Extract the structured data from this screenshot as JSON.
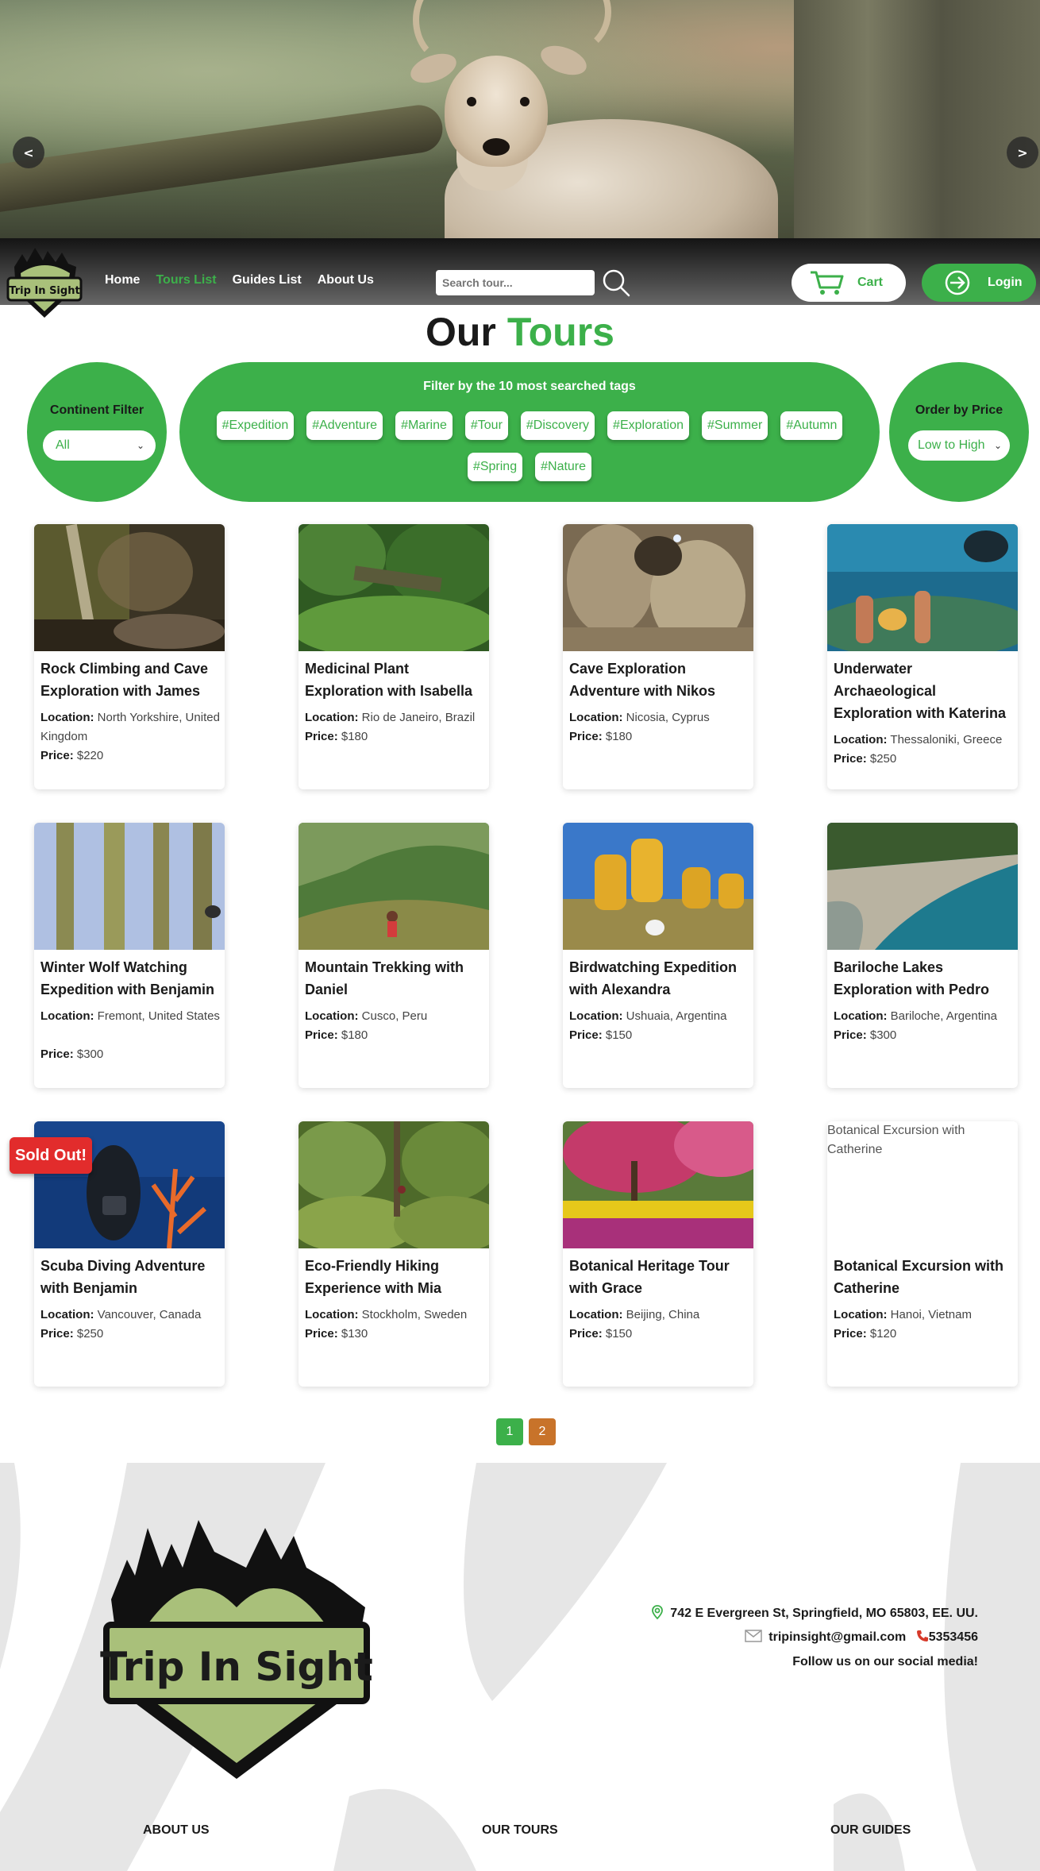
{
  "brand": {
    "name": "Trip In Sight"
  },
  "hero": {
    "prev_label": "<",
    "next_label": ">"
  },
  "nav": {
    "links": [
      "Home",
      "Tours List",
      "Guides List",
      "About Us"
    ],
    "active": "Tours List",
    "search_placeholder": "Search tour...",
    "cart_label": "Cart",
    "login_label": "Login"
  },
  "title": {
    "part1": "Our",
    "part2": "Tours"
  },
  "filters": {
    "continent_label": "Continent Filter",
    "continent_value": "All",
    "tags_title": "Filter by the 10 most searched tags",
    "tags": [
      "#Expedition",
      "#Adventure",
      "#Marine",
      "#Tour",
      "#Discovery",
      "#Exploration",
      "#Summer",
      "#Autumn",
      "#Spring",
      "#Nature"
    ],
    "order_label": "Order by Price",
    "order_value": "Low to High"
  },
  "tours": [
    {
      "title": "Rock Climbing and Cave Exploration with James",
      "location": "North Yorkshire, United Kingdom",
      "price": "$220",
      "image": "cave-forest"
    },
    {
      "title": "Medicinal Plant Exploration with Isabella",
      "location": "Rio de Janeiro, Brazil",
      "price": "$180",
      "image": "rainforest"
    },
    {
      "title": "Cave Exploration Adventure with Nikos",
      "location": "Nicosia, Cyprus",
      "price": "$180",
      "image": "cave"
    },
    {
      "title": "Underwater Archaeological Exploration with Katerina",
      "location": "Thessaloniki, Greece",
      "price": "$250",
      "image": "underwater-ruins"
    },
    {
      "title": "Winter Wolf Watching Expedition with Benjamin",
      "location": "Fremont, United States",
      "price": "$300",
      "image": "snowy-forest"
    },
    {
      "title": "Mountain Trekking with Daniel",
      "location": "Cusco, Peru",
      "price": "$180",
      "image": "mountain-trek"
    },
    {
      "title": "Birdwatching Expedition with Alexandra",
      "location": "Ushuaia, Argentina",
      "price": "$150",
      "image": "birdwatchers"
    },
    {
      "title": "Bariloche Lakes Exploration with Pedro",
      "location": "Bariloche, Argentina",
      "price": "$300",
      "image": "lake-shore"
    },
    {
      "title": "Scuba Diving Adventure with Benjamin",
      "location": "Vancouver, Canada",
      "price": "$250",
      "image": "scuba-diver",
      "badge": "Sold Out!"
    },
    {
      "title": "Eco-Friendly Hiking Experience with Mia",
      "location": "Stockholm, Sweden",
      "price": "$130",
      "image": "mossy-trail"
    },
    {
      "title": "Botanical Heritage Tour with Grace",
      "location": "Beijing, China",
      "price": "$150",
      "image": "tulip-garden"
    },
    {
      "title": "Botanical Excursion with Catherine",
      "location": "Hanoi, Vietnam",
      "price": "$120",
      "image_alt": "Botanical Excursion with Catherine"
    }
  ],
  "labels": {
    "location": "Location:",
    "price": "Price:"
  },
  "pagination": {
    "pages": [
      "1",
      "2"
    ],
    "current": "1"
  },
  "footer": {
    "address": "742 E Evergreen St, Springfield, MO 65803, EE. UU.",
    "email": "tripinsight@gmail.com",
    "phone": "5353456",
    "social": "Follow us on our social media!",
    "columns": [
      "ABOUT US",
      "OUR TOURS",
      "OUR GUIDES"
    ]
  },
  "colors": {
    "accent": "#3cb04a",
    "page2": "#c8732a",
    "sold": "#e22c2c",
    "logo_green": "#a9c07a"
  }
}
